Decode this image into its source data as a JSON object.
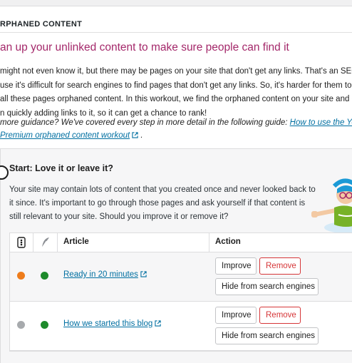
{
  "section_title": "RPHANED CONTENT",
  "headline": "an up your unlinked content to make sure people can find it",
  "intro_lines": [
    "might not even know it, but there may be pages on your site that don't get any links. That's an SEO iss",
    "use it's difficult for search engines to find pages that don't get any links. So, it's harder for them to ra",
    "all these pages orphaned content. In this workout, we find the orphaned content on your site and gui",
    "n quickly adding links to it, so it can get a chance to rank!"
  ],
  "guide": {
    "prefix": "more guidance? We've covered every step in more detail in the following guide: ",
    "link_line1": "How to use the Yoa",
    "link_line2": "Premium orphaned content workout",
    "suffix": " ."
  },
  "step": {
    "title": "Start: Love it or leave it?",
    "text_lines": [
      "Your site may contain lots of content that you created once and never looked back to",
      "it since. It's important to go through those pages and ask yourself if that content is",
      "still relevant to your site. Should you improve it or remove it?"
    ]
  },
  "table": {
    "headers": {
      "article": "Article",
      "action": "Action"
    },
    "rows": [
      {
        "article": "Ready in 20 minutes",
        "seo_color": "#ee7c1b",
        "readability_color": "#1e8a2b",
        "improve": "Improve",
        "remove": "Remove",
        "hide": "Hide from search engines"
      },
      {
        "article": "How we started this blog",
        "seo_color": "#a7aaad",
        "readability_color": "#1e8a2b",
        "improve": "Improve",
        "remove": "Remove",
        "hide": "Hide from search engines"
      }
    ]
  },
  "colors": {
    "headline": "#a4286a",
    "link": "#006fa1",
    "remove": "#d63638"
  }
}
